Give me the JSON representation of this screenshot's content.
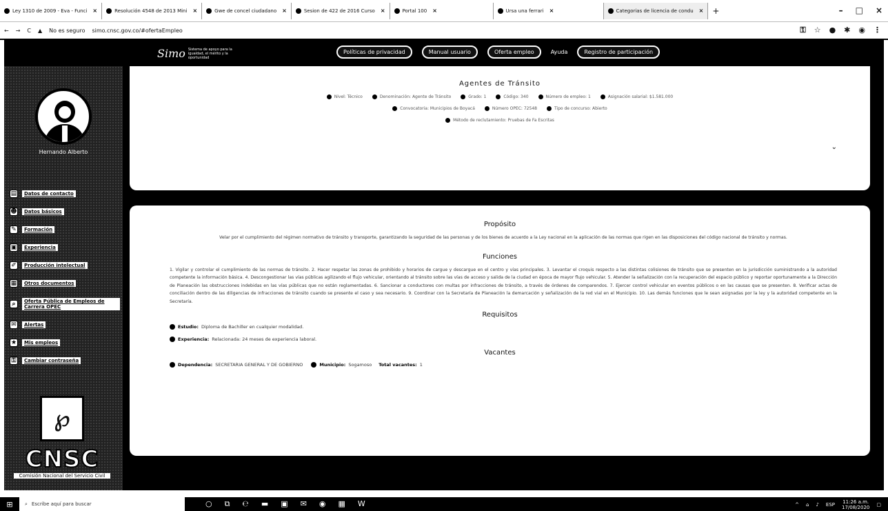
{
  "browser": {
    "tabs": [
      {
        "label": "Ley 1310 de 2009 - Eva - Funci"
      },
      {
        "label": "Resolución 4548 de 2013 Mini"
      },
      {
        "label": "Gwe de concel ciudadano"
      },
      {
        "label": "Sesion de 422 de 2016 Curso"
      },
      {
        "label": "Portal 100"
      },
      {
        "label": "Ursa una ferrari"
      },
      {
        "label": "Categorias de licencia de condu"
      }
    ],
    "url": "simo.cnsc.gov.co/#ofertaEmpleo",
    "security_label": "No es seguro"
  },
  "header": {
    "brand": "Simo",
    "brand_sub": "Sistema de apoyo para la igualdad, el mérito y la oportunidad",
    "nav": [
      "Políticas de privacidad",
      "Manual usuario",
      "Oferta empleo"
    ],
    "nav_text": "Ayuda",
    "nav_last": "Registro de participación"
  },
  "sidebar": {
    "user_name": "Hernando Alberto",
    "items": [
      {
        "label": "Datos de contacto",
        "icon": "id-card-icon",
        "glyph": "▤"
      },
      {
        "label": "Datos básicos",
        "icon": "person-icon",
        "glyph": "☻"
      },
      {
        "label": "Formación",
        "icon": "graduation-icon",
        "glyph": "✎"
      },
      {
        "label": "Experiencia",
        "icon": "briefcase-icon",
        "glyph": "▣"
      },
      {
        "label": "Producción intelectual",
        "icon": "book-icon",
        "glyph": "✐"
      },
      {
        "label": "Otros documentos",
        "icon": "document-icon",
        "glyph": "▦"
      },
      {
        "label": "Oferta Pública de Empleos de Carrera OPEC",
        "icon": "search-icon",
        "glyph": "⌕"
      },
      {
        "label": "Alertas",
        "icon": "bell-icon",
        "glyph": "✉"
      },
      {
        "label": "Mis empleos",
        "icon": "star-icon",
        "glyph": "★"
      },
      {
        "label": "Cambiar contraseña",
        "icon": "key-icon",
        "glyph": "⚿"
      }
    ],
    "logo_word": "CNSC",
    "logo_sub": "Comisión Nacional del Servicio Civil"
  },
  "card1": {
    "title": "Agentes de Tránsito",
    "meta_row1": [
      "Nivel: Técnico",
      "Denominación: Agente de Tránsito",
      "Grado: 1",
      "Código: 340",
      "Número de empleo: 1",
      "Asignación salarial: $1.581.000"
    ],
    "meta_row2": [
      "Convocatoria: Municipios de Boyacá",
      "Número OPEC: 72548",
      "Tipo de concurso: Abierto"
    ],
    "meta_row3": "Método de reclutamiento: Pruebas de Fa Escritas"
  },
  "card2": {
    "proposito_title": "Propósito",
    "proposito_text": "Velar por el cumplimiento del régimen normativo de tránsito y transporte, garantizando la seguridad de las personas y de los bienes de acuerdo a la Ley nacional en la aplicación de las normas que rigen en las disposiciones del código nacional de tránsito y normas.",
    "funciones_title": "Funciones",
    "funciones_text": "1. Vigilar y controlar el cumplimiento de las normas de tránsito. 2. Hacer respetar las zonas de prohibido y horarios de cargue y descargue en el centro y vías principales. 3. Levantar el croquis respecto a las distintas colisiones de tránsito que se presenten en la jurisdicción suministrando a la autoridad competente la información básica. 4. Descongestionar las vías públicas agilizando el flujo vehicular, orientando al tránsito sobre las vías de acceso y salida de la ciudad en época de mayor flujo vehicular. 5. Atender la señalización con la recuperación del espacio público y reportar oportunamente a la Dirección de Planeación las obstrucciones indebidas en las vías públicas que no están reglamentadas. 6. Sancionar a conductores con multas por infracciones de tránsito, a través de órdenes de comparendos. 7. Ejercer control vehicular en eventos públicos o en las causas que se presenten. 8. Verificar actas de conciliación dentro de las diligencias de infracciones de tránsito cuando se presente el caso y sea necesario. 9. Coordinar con la Secretaría de Planeación la demarcación y señalización de la red vial en el Municipio. 10. Las demás funciones que le sean asignadas por la ley y la autoridad competente en la Secretaría.",
    "requisitos_title": "Requisitos",
    "estudio_label": "Estudio:",
    "estudio_value": "Diploma de Bachiller en cualquier modalidad.",
    "experiencia_label": "Experiencia:",
    "experiencia_value": "Relacionada: 24 meses de experiencia laboral.",
    "vacantes_title": "Vacantes",
    "dependencia_label": "Dependencia:",
    "dependencia_value": "SECRETARIA GENERAL Y DE GOBIERNO",
    "municipio_label": "Municipio:",
    "municipio_value": "Sogamoso",
    "total_label": "Total vacantes:",
    "total_value": "1"
  },
  "taskbar": {
    "search_placeholder": "Escribe aquí para buscar",
    "time": "11:26 a.m.",
    "date": "17/08/2020",
    "lang": "ESP"
  }
}
